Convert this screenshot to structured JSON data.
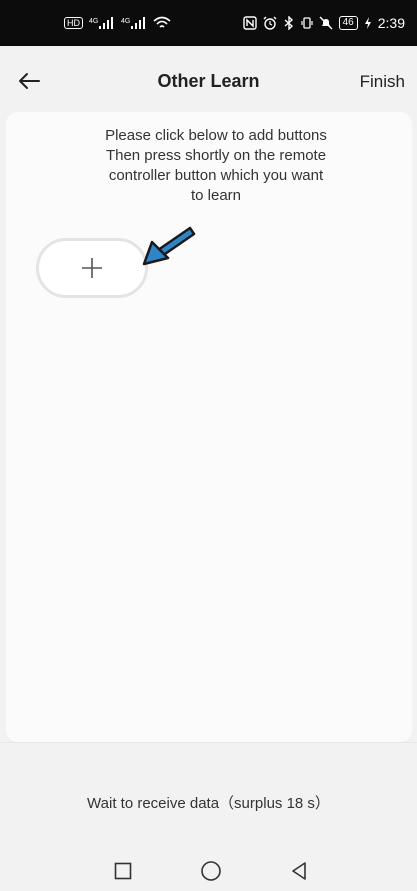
{
  "status_bar": {
    "hd": "HD",
    "signal_1": "4G",
    "signal_2": "4G",
    "battery": "46",
    "time": "2:39"
  },
  "header": {
    "title": "Other Learn",
    "finish_label": "Finish",
    "back_icon": "arrow-left-icon"
  },
  "instructions": {
    "line1": "Please click below to add buttons",
    "line2": "Then press shortly on the remote",
    "line3": "controller button which you want",
    "line4": "to learn"
  },
  "add_button": {
    "icon": "plus-icon"
  },
  "status": {
    "text": "Wait to receive data（surplus 18 s）"
  },
  "nav": {
    "recent": "square-icon",
    "home": "circle-icon",
    "back": "triangle-back-icon"
  },
  "colors": {
    "accent_arrow": "#2f86c6",
    "status_bar_bg": "#0c0c0c",
    "page_bg": "#f2f2f2"
  }
}
